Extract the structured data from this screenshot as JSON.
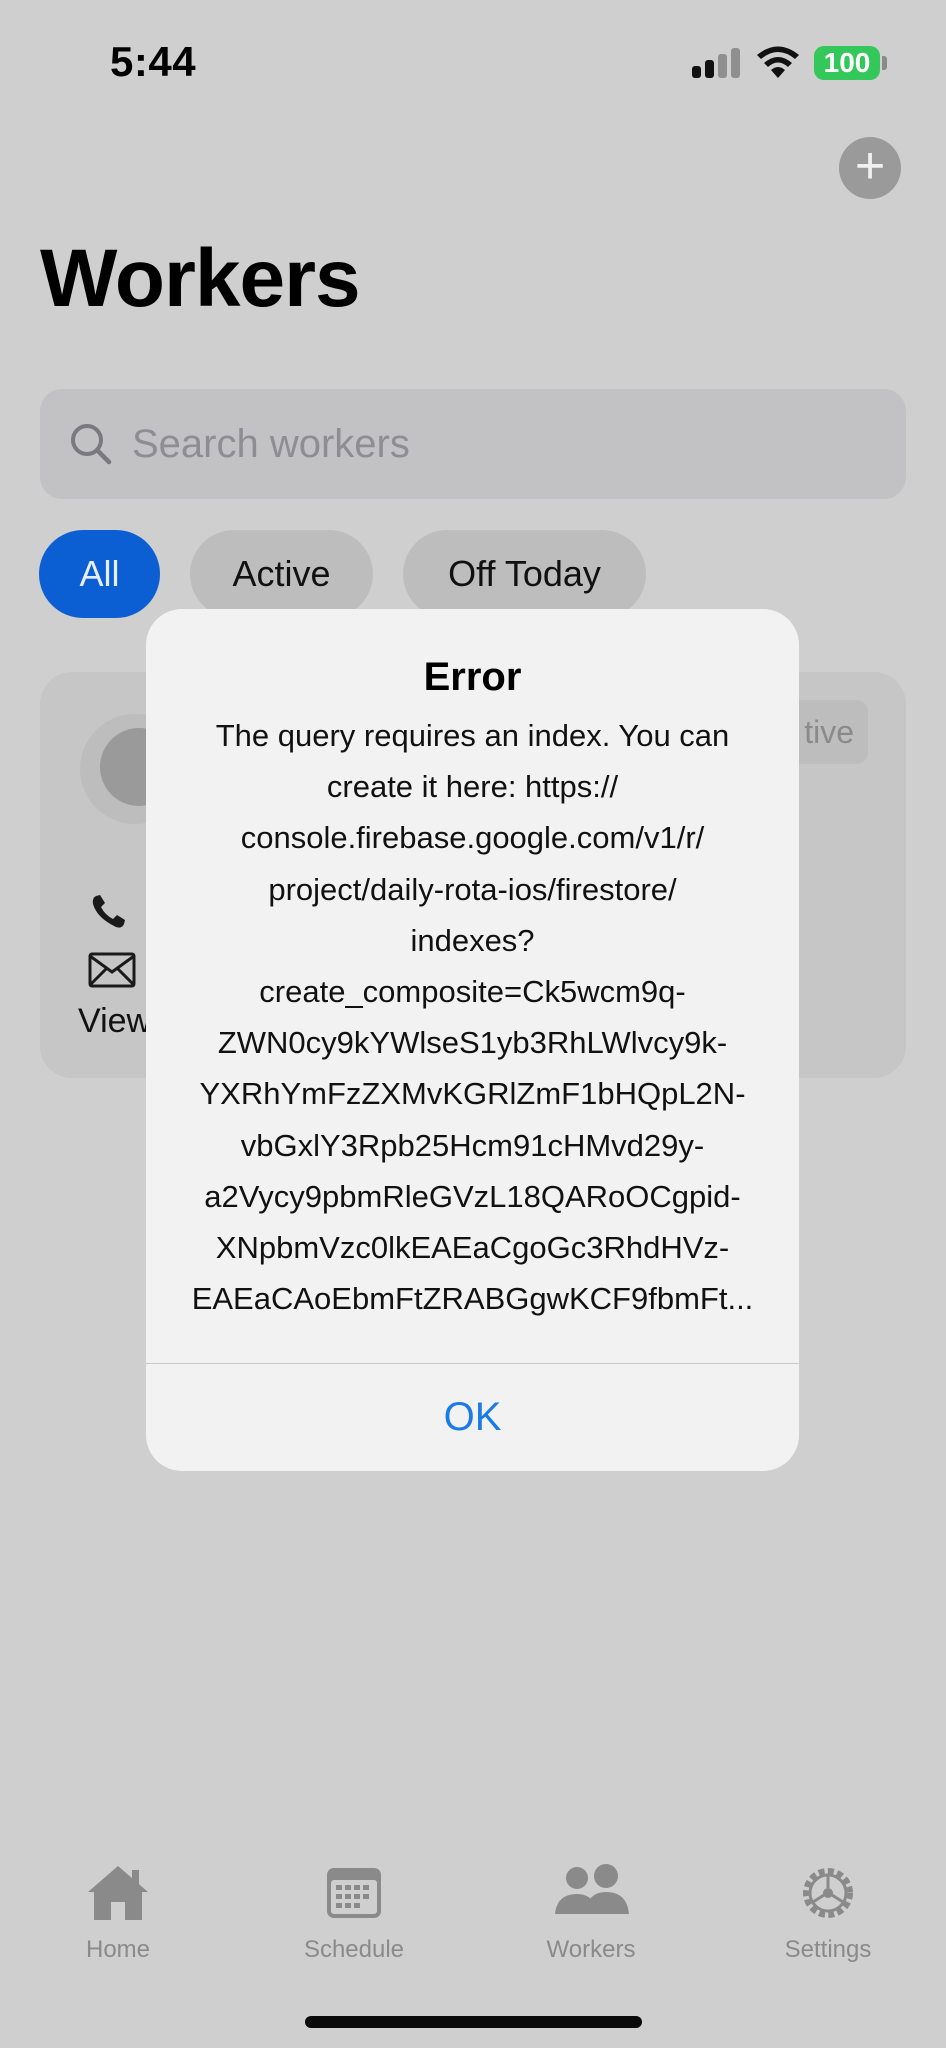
{
  "status_bar": {
    "time": "5:44",
    "battery_level": "100",
    "battery_color": "#34c759"
  },
  "header": {
    "title": "Workers",
    "add_icon": "plus-icon"
  },
  "search": {
    "placeholder": "Search workers",
    "value": ""
  },
  "filters": {
    "selected": "All",
    "items": [
      {
        "label": "All"
      },
      {
        "label": "Active"
      },
      {
        "label": "Off Today"
      }
    ]
  },
  "worker_card": {
    "status_partial": "tive",
    "view_partial": "View"
  },
  "alert": {
    "title": "Error",
    "message_lines": [
      "The query requires an index. You can",
      "create it here: https://",
      "console.firebase.google.com/v1/r/",
      "project/daily-rota-ios/firestore/",
      "indexes?",
      "create_composite=Ck5wcm9q-",
      "ZWN0cy9kYWlseS1yb3RhLWlvcy9k-",
      "YXRhYmFzZXMvKGRlZmF1bHQpL2N-",
      "vbGxlY3Rpb25Hcm91cHMvd29y-",
      "a2Vycy9pbmRleGVzL18QARoOCgpid-",
      "XNpbmVzc0lkEAEaCgoGc3RhdHVz-",
      "EAEaCAoEbmFtZRABGgwKCF9fbmFt..."
    ],
    "ok_label": "OK",
    "ok_color": "#1a7ae8"
  },
  "tab_bar": {
    "items": [
      {
        "label": "Home",
        "icon": "house-icon"
      },
      {
        "label": "Schedule",
        "icon": "calendar-icon"
      },
      {
        "label": "Workers",
        "icon": "people-icon"
      },
      {
        "label": "Settings",
        "icon": "gear-icon"
      }
    ]
  },
  "colors": {
    "accent": "#0b5fd3",
    "background": "#cfcfcf"
  }
}
